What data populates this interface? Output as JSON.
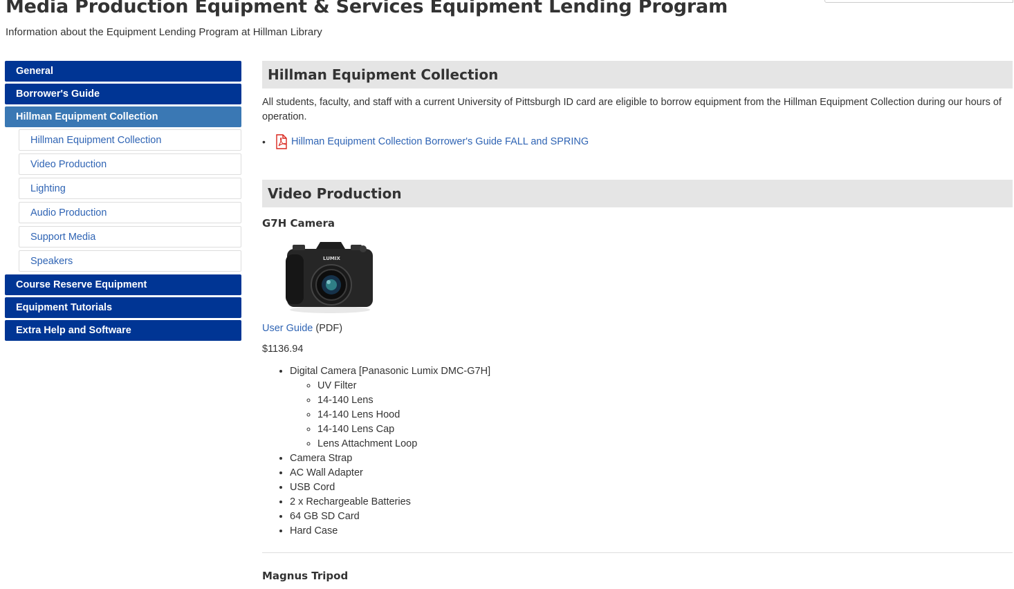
{
  "page": {
    "title": "Media Production Equipment & Services Equipment Lending Program",
    "subtitle": "Information about the Equipment Lending Program at Hillman Library"
  },
  "sidebar": {
    "items_top": [
      "General",
      "Borrower's Guide"
    ],
    "active": "Hillman Equipment Collection",
    "sub_items": [
      "Hillman Equipment Collection",
      "Video Production",
      "Lighting",
      "Audio Production",
      "Support Media",
      "Speakers"
    ],
    "items_bottom": [
      "Course Reserve Equipment",
      "Equipment Tutorials",
      "Extra Help and Software"
    ]
  },
  "collection": {
    "heading": "Hillman Equipment Collection",
    "intro": "All students, faculty, and staff with a current University of Pittsburgh ID card are eligible to borrow equipment from the Hillman Equipment Collection during our hours of operation.",
    "guide_link": "Hillman Equipment Collection Borrower's Guide FALL and SPRING"
  },
  "video": {
    "heading": "Video Production",
    "item1": {
      "title": "G7H Camera",
      "camera_brand": "LUMIX",
      "user_guide_link": "User Guide",
      "user_guide_suffix": " (PDF)",
      "price": "$1136.94",
      "main_item": "Digital Camera [Panasonic Lumix DMC-G7H]",
      "sub_items": [
        "UV Filter",
        "14-140 Lens",
        "14-140 Lens Hood",
        "14-140 Lens Cap",
        "Lens Attachment Loop"
      ],
      "accessories": [
        "Camera Strap",
        "AC Wall Adapter",
        "USB Cord",
        "2 x Rechargeable Batteries",
        "64 GB SD Card",
        "Hard Case"
      ]
    },
    "item2": {
      "title": "Magnus Tripod"
    }
  },
  "colors": {
    "nav": "#003594",
    "nav_active": "#3a78b4",
    "link": "#2f64b4",
    "heading_bg": "#e5e5e5"
  }
}
